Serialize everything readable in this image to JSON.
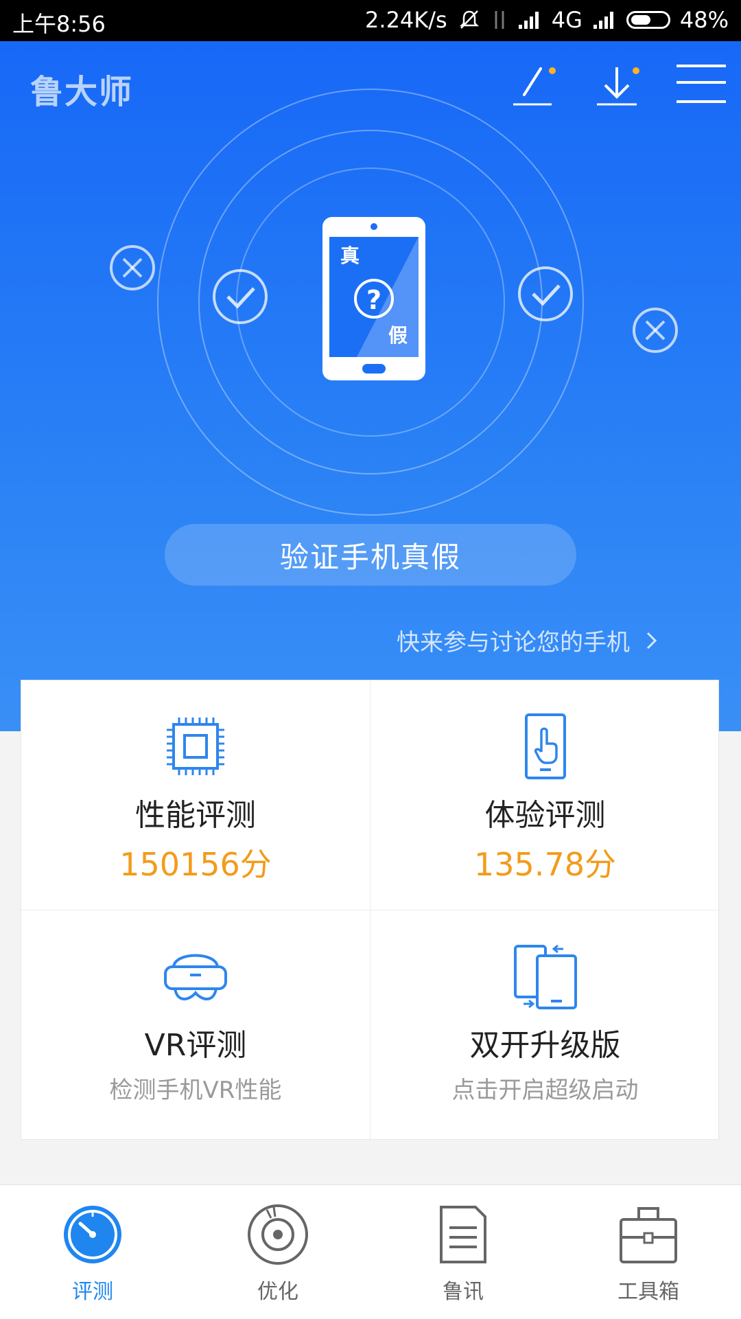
{
  "status_bar": {
    "time": "上午8:56",
    "speed": "2.24K/s",
    "network": "4G",
    "battery": "48%"
  },
  "header": {
    "app_name": "鲁大师",
    "icons": [
      "edit-icon",
      "download-icon",
      "menu-icon"
    ],
    "notification_dot_color": "#ffb224"
  },
  "hero": {
    "phone_text_top": "真",
    "phone_text_bottom": "假",
    "phone_center_symbol": "?",
    "verify_button": "验证手机真假",
    "discuss_link": "快来参与讨论您的手机"
  },
  "cards": [
    {
      "title": "性能评测",
      "score": "150156分",
      "icon": "chip-icon"
    },
    {
      "title": "体验评测",
      "score": "135.78分",
      "icon": "touch-phone-icon"
    },
    {
      "title": "VR评测",
      "subtitle": "检测手机VR性能",
      "icon": "vr-headset-icon"
    },
    {
      "title": "双开升级版",
      "subtitle": "点击开启超级启动",
      "icon": "dual-phone-icon"
    }
  ],
  "tabs": [
    {
      "label": "评测",
      "icon": "gauge-icon",
      "active": true
    },
    {
      "label": "优化",
      "icon": "disc-icon",
      "active": false
    },
    {
      "label": "鲁讯",
      "icon": "document-icon",
      "active": false
    },
    {
      "label": "工具箱",
      "icon": "toolbox-icon",
      "active": false
    }
  ],
  "colors": {
    "brand_blue": "#1768f7",
    "score_orange": "#f39b1b",
    "active_tab": "#1f86f0"
  }
}
